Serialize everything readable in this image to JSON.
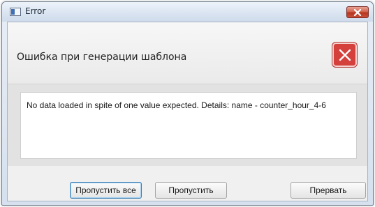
{
  "window": {
    "title": "Error",
    "close_icon": "close-icon"
  },
  "header": {
    "text": "Ошибка при генерации шаблона",
    "icon": "error-x-icon",
    "icon_color": "#d4403b"
  },
  "message": {
    "text": "No data loaded in spite of one value expected.  Details: name - counter_hour_4-6"
  },
  "buttons": {
    "skip_all": "Пропустить все",
    "skip": "Пропустить",
    "abort": "Прервать"
  }
}
